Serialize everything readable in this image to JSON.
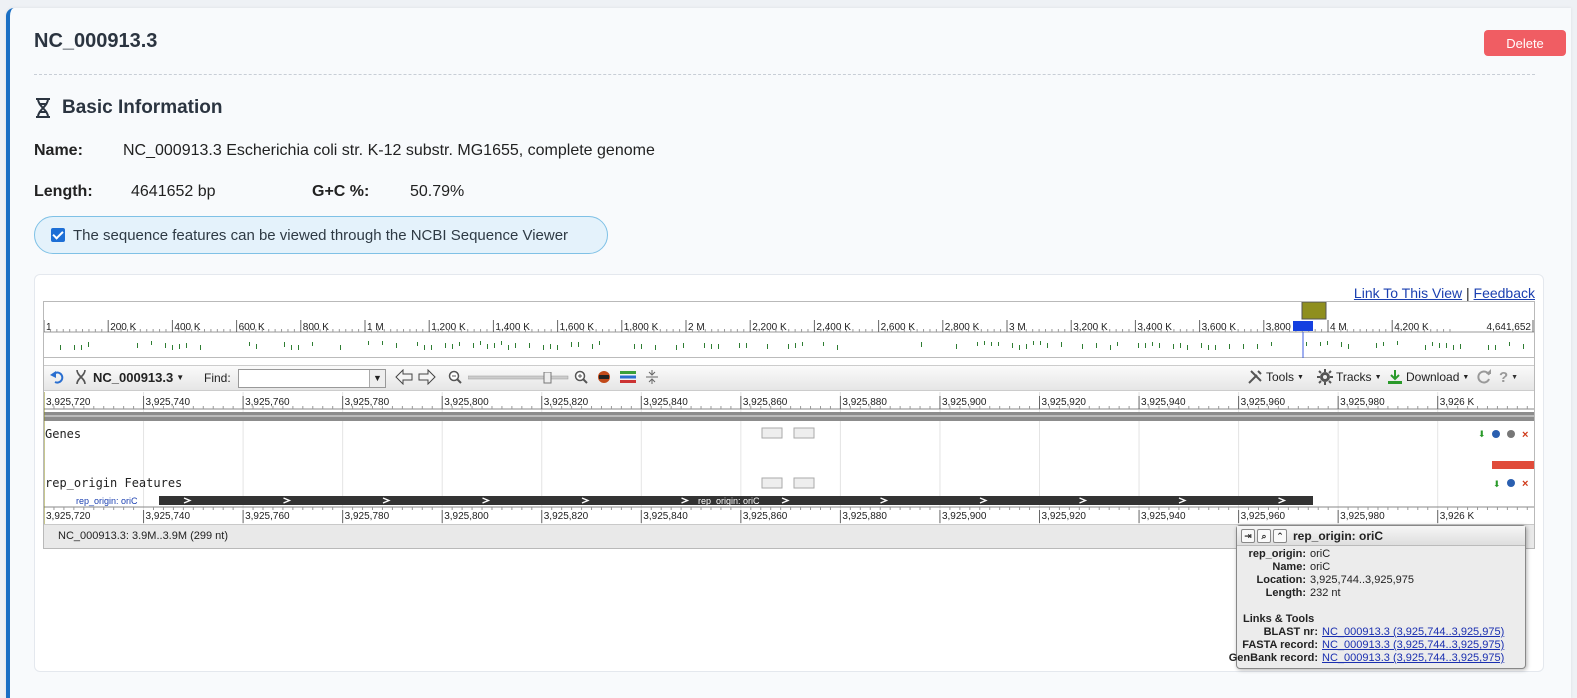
{
  "header": {
    "title": "NC_000913.3",
    "delete_label": "Delete"
  },
  "basic_info": {
    "section_title": "Basic Information",
    "name_label": "Name:",
    "name_value": "NC_000913.3 Escherichia coli str. K-12 substr. MG1655, complete genome",
    "length_label": "Length:",
    "length_value": "4641652 bp",
    "gc_label": "G+C %:",
    "gc_value": "50.79%"
  },
  "notice": {
    "text": "The sequence features can be viewed through the NCBI Sequence Viewer",
    "checked": true
  },
  "viewer": {
    "link_view": "Link To This View",
    "link_sep": "|",
    "link_feedback": "Feedback",
    "overview_ticks": [
      "1",
      "200 K",
      "400 K",
      "600 K",
      "800 K",
      "1 M",
      "1,200 K",
      "1,400 K",
      "1,600 K",
      "1,800 K",
      "2 M",
      "2,200 K",
      "2,400 K",
      "2,600 K",
      "2,800 K",
      "3 M",
      "3,200 K",
      "3,400 K",
      "3,600 K",
      "3,800 K",
      "4 M",
      "4,200 K",
      "4,641,652"
    ],
    "toolbar": {
      "seq_name": "NC_000913.3",
      "find_label": "Find:",
      "find_value": "",
      "tools_label": "Tools",
      "tracks_label": "Tracks",
      "download_label": "Download"
    },
    "ruler_ticks": [
      "3,925,720",
      "3,925,740",
      "3,925,760",
      "3,925,780",
      "3,925,800",
      "3,925,820",
      "3,925,840",
      "3,925,860",
      "3,925,880",
      "3,925,900",
      "3,925,920",
      "3,925,940",
      "3,925,960",
      "3,925,980",
      "3,926 K"
    ],
    "tracks": {
      "genes_label": "Genes",
      "rep_label": "rep_origin Features",
      "feature_side_label": "rep_origin: oriC",
      "feature_bar_label": "rep_origin: oriC"
    },
    "status": "NC_000913.3: 3.9M..3.9M (299 nt)"
  },
  "tooltip": {
    "title": "rep_origin: oriC",
    "rows": [
      {
        "key": "rep_origin:",
        "value": "oriC"
      },
      {
        "key": "Name:",
        "value": "oriC"
      },
      {
        "key": "Location:",
        "value": "3,925,744..3,925,975"
      },
      {
        "key": "Length:",
        "value": "232 nt"
      }
    ],
    "links_title": "Links & Tools",
    "links": [
      {
        "key": "BLAST nr:",
        "value": "NC_000913.3 (3,925,744..3,925,975)"
      },
      {
        "key": "FASTA record:",
        "value": "NC_000913.3 (3,925,744..3,925,975)"
      },
      {
        "key": "GenBank record:",
        "value": "NC_000913.3 (3,925,744..3,925,975)"
      }
    ]
  },
  "colors": {
    "accent": "#1a6fc4",
    "delete": "#f05d63",
    "feature": "#333333",
    "marker": "#8f8f1e"
  }
}
